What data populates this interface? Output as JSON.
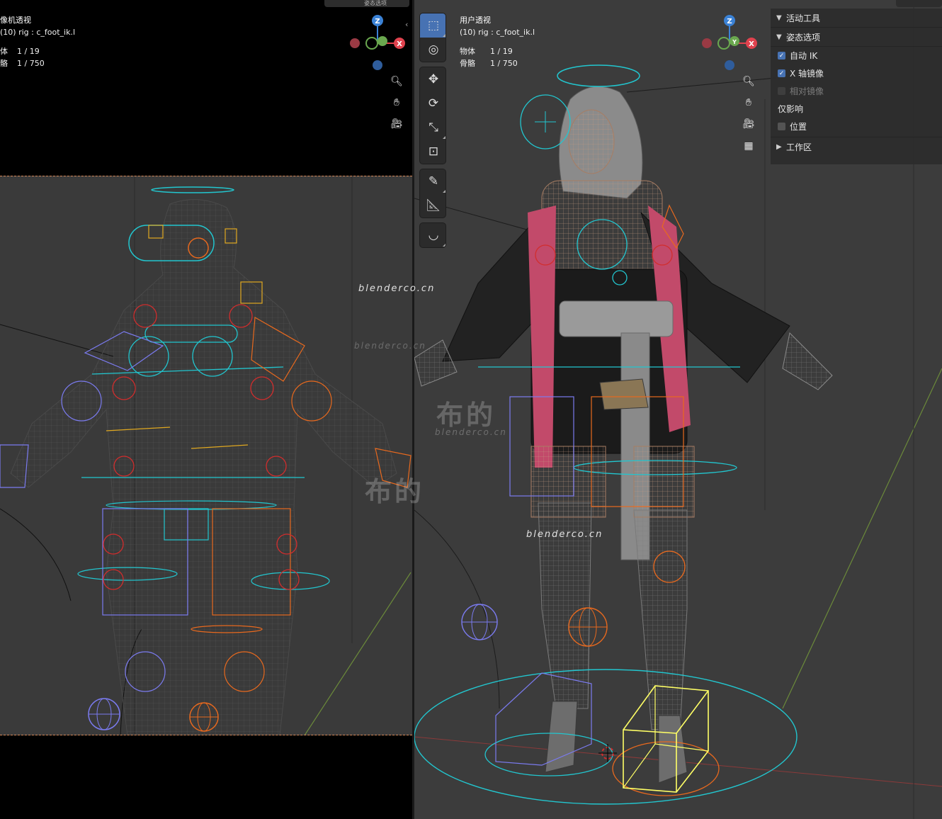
{
  "left_viewport": {
    "title": "摄像机透视",
    "subtitle": "(10) rig : c_foot_ik.l",
    "stats": [
      {
        "label": "物体",
        "value": "1 / 19"
      },
      {
        "label": "骨骼",
        "value": "1 / 750"
      }
    ],
    "title_visible": "像机透视",
    "stat_labels_visible": [
      "体",
      "骼"
    ],
    "header_chip": "姿态选项"
  },
  "right_viewport": {
    "title": "用户透视",
    "subtitle": "(10) rig : c_foot_ik.l",
    "stats": [
      {
        "label": "物体",
        "value": "1 / 19"
      },
      {
        "label": "骨骼",
        "value": "1 / 750"
      }
    ]
  },
  "gizmo": {
    "z": "Z",
    "x": "X",
    "y": "Y"
  },
  "toolbar": {
    "tools": [
      "select-box",
      "cursor",
      "move",
      "rotate",
      "scale",
      "transform",
      "annotate",
      "measure",
      "bone-curve"
    ],
    "active": "select-box"
  },
  "npanel": {
    "active_tool_header": "活动工具",
    "pose_options_header": "姿态选项",
    "auto_ik_label": "自动 IK",
    "auto_ik_checked": true,
    "x_mirror_label": "X 轴镜像",
    "x_mirror_checked": true,
    "relative_mirror_label": "相对镜像",
    "relative_mirror_checked": false,
    "affect_only_label": "仅影响",
    "location_label": "位置",
    "location_checked": false,
    "workspace_header": "工作区"
  },
  "watermarks": {
    "site": "blenderco.cn",
    "brand": "布的"
  },
  "colors": {
    "bone_cyan": "#22c6cf",
    "bone_orange": "#e8691e",
    "bone_blue": "#7b7bf0",
    "bone_red": "#d22d2d",
    "bone_yellow": "#e0a820",
    "gizmo_x": "#e0424e",
    "gizmo_y": "#6aa84f",
    "gizmo_z": "#3b82d6",
    "selected": "#ffff66",
    "accent": "#4772b3"
  }
}
